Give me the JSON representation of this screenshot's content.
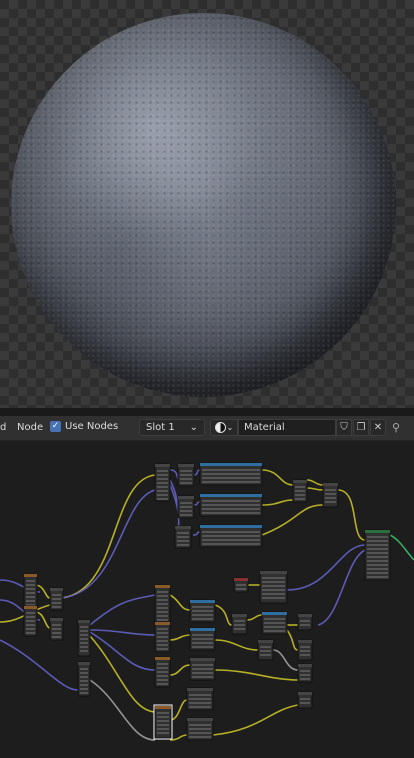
{
  "header": {
    "menu_partial": "d",
    "menu_node": "Node",
    "use_nodes_label": "Use Nodes",
    "use_nodes_checked": true,
    "slot_value": "Slot 1",
    "material_name": "Material",
    "icons": [
      "shader-ball-icon",
      "chevron-down-icon",
      "shield-icon",
      "copy-icon",
      "close-icon",
      "pin-icon"
    ]
  },
  "colors": {
    "viewport_checker_dark": "#2e2e2e",
    "viewport_checker_light": "#3a3a3a",
    "editor_bg": "#1d1d1d",
    "header_bg": "#303030",
    "accent_blue": "#4772b3",
    "wire_yellow": "#c7c029",
    "wire_purple": "#6363c7",
    "wire_grey": "#a1a1a1",
    "wire_green": "#3ebd6b"
  }
}
